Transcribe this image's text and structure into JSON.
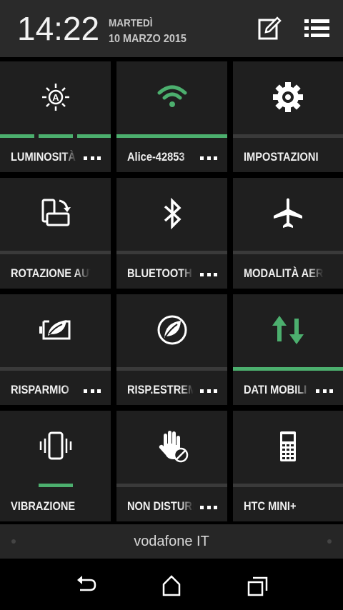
{
  "header": {
    "time": "14:22",
    "day": "MARTEDÌ",
    "date": "10 MARZO 2015"
  },
  "tiles": [
    {
      "label": "LUMINOSITÀ",
      "icon": "brightness-auto-icon"
    },
    {
      "label": "Alice-42853",
      "icon": "wifi-icon"
    },
    {
      "label": "IMPOSTAZIONI",
      "icon": "gear-icon"
    },
    {
      "label": "ROTAZIONE AUTO",
      "icon": "rotation-icon"
    },
    {
      "label": "BLUETOOTH",
      "icon": "bluetooth-icon"
    },
    {
      "label": "MODALITÀ AEREO",
      "icon": "airplane-icon"
    },
    {
      "label": "RISPARMIO",
      "icon": "battery-leaf-icon"
    },
    {
      "label": "RISP.ESTREMO",
      "icon": "leaf-circle-icon"
    },
    {
      "label": "DATI MOBILI",
      "icon": "data-arrows-icon"
    },
    {
      "label": "VIBRAZIONE",
      "icon": "vibrate-icon"
    },
    {
      "label": "NON DISTURBARE",
      "icon": "do-not-disturb-icon"
    },
    {
      "label": "HTC MINI+",
      "icon": "htc-mini-icon"
    }
  ],
  "carrier": "vodafone IT",
  "colors": {
    "accent": "#4caf6e",
    "tile": "#1f1f1f",
    "header": "#2a2a2a"
  }
}
